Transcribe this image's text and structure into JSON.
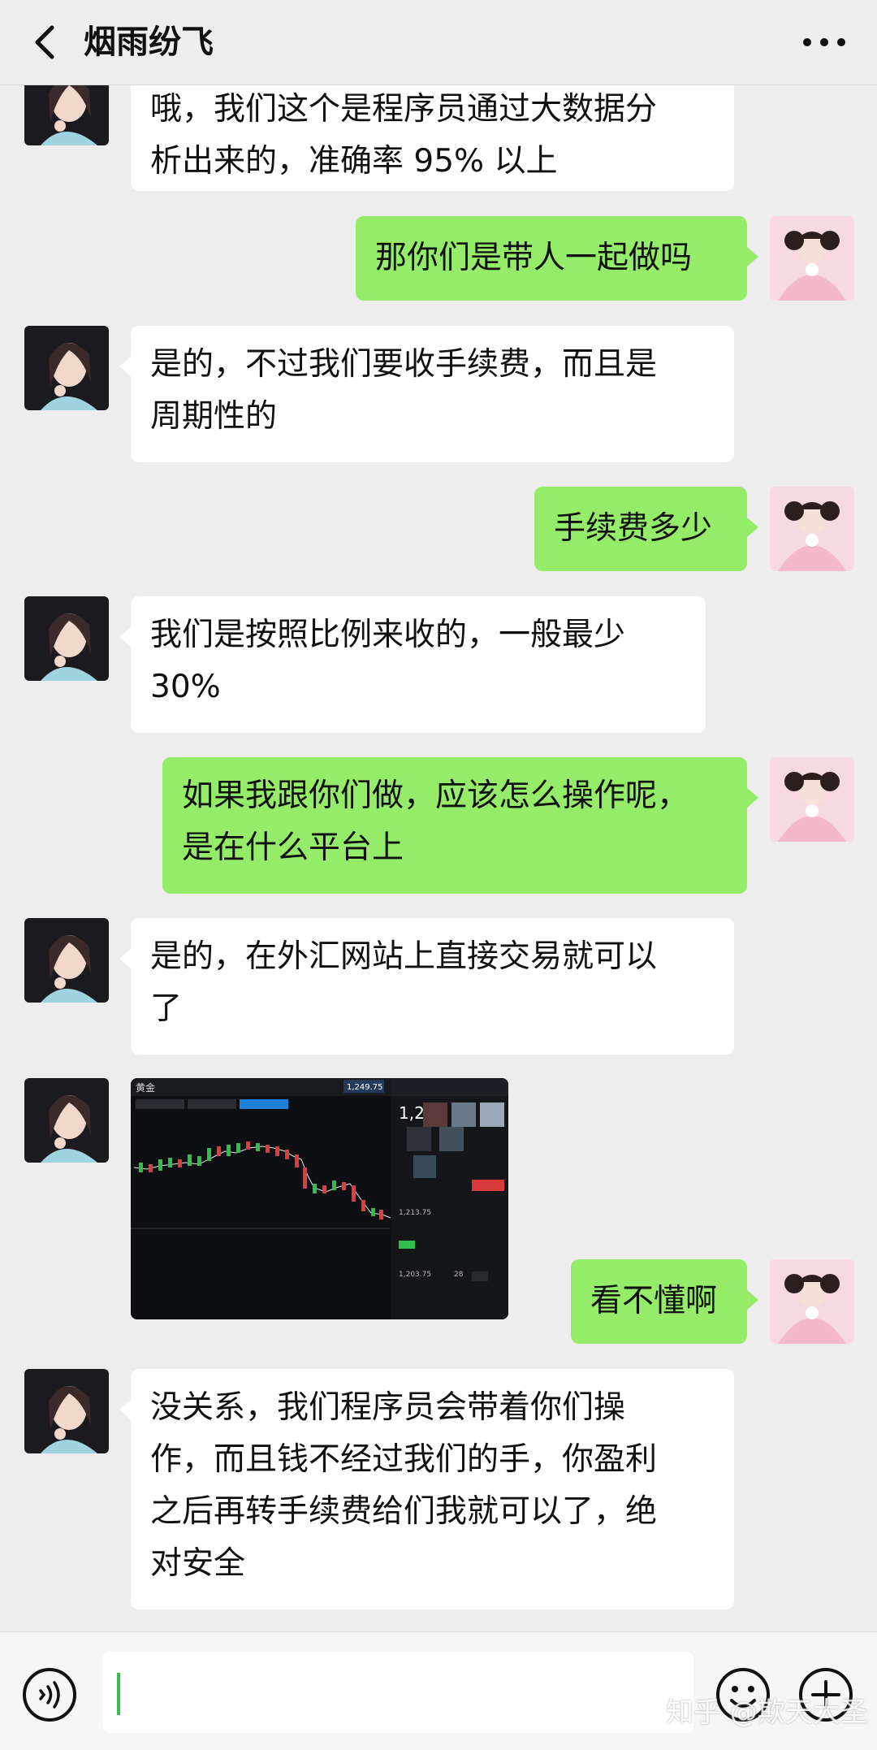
{
  "header": {
    "title": "烟雨纷飞",
    "back_icon": "back-arrow-icon",
    "more_icon": "more-dots-icon"
  },
  "messages": [
    {
      "side": "in",
      "lines": [
        "哦，我们这个是程序员通过大数据分",
        "析出来的，准确率 95% 以上"
      ]
    },
    {
      "side": "out",
      "lines": [
        "那你们是带人一起做吗"
      ]
    },
    {
      "side": "in",
      "lines": [
        "是的，不过我们要收手续费，而且是",
        "周期性的"
      ]
    },
    {
      "side": "out",
      "lines": [
        "手续费多少"
      ]
    },
    {
      "side": "in",
      "lines": [
        "我们是按照比例来收的，一般最少",
        "30%"
      ]
    },
    {
      "side": "out",
      "lines": [
        "如果我跟你们做，应该怎么操作呢，",
        "是在什么平台上"
      ]
    },
    {
      "side": "in",
      "lines": [
        "是的，在外汇网站上直接交易就可以",
        "了"
      ]
    },
    {
      "side": "in",
      "type": "image",
      "image_caption": "trading-chart-screenshot",
      "image_texts": [
        "黄金",
        "1,249.75",
        "1,24",
        "1,213.75",
        "1,203.75",
        "28"
      ]
    },
    {
      "side": "out",
      "lines": [
        "看不懂啊"
      ]
    },
    {
      "side": "in",
      "lines": [
        "没关系，我们程序员会带着你们操",
        "作，而且钱不经过我们的手，你盈利",
        "之后再转手续费给们我就可以了，绝",
        "对安全"
      ]
    }
  ],
  "input": {
    "value": "",
    "voice_icon": "voice-icon",
    "emoji_icon": "emoji-icon",
    "plus_icon": "plus-icon"
  },
  "watermark": "知乎 @欺天大圣",
  "colors": {
    "background": "#ededed",
    "incoming_bubble": "#ffffff",
    "outgoing_bubble": "#95ec69",
    "cursor": "#2fbf4a"
  }
}
